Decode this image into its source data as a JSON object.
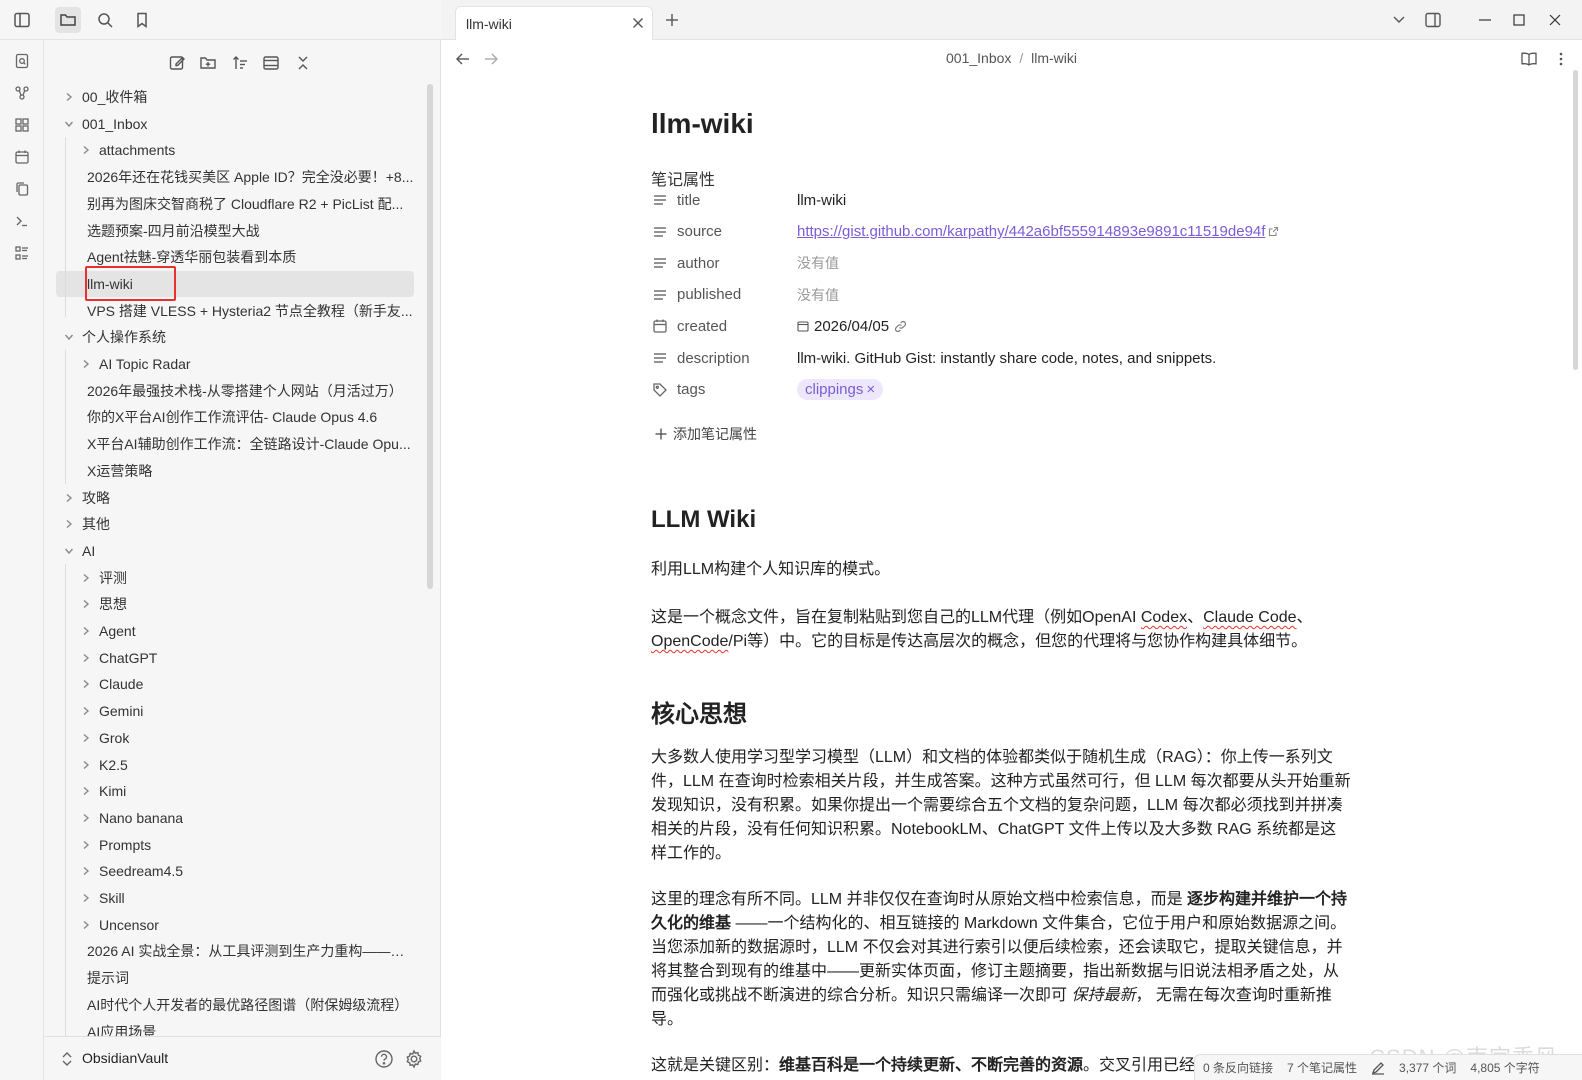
{
  "tab": {
    "title": "llm-wiki"
  },
  "breadcrumb": {
    "folder": "001_Inbox",
    "sep": "/",
    "note": "llm-wiki"
  },
  "tree": [
    {
      "label": "00_收件箱",
      "chev": "right",
      "level": 0
    },
    {
      "label": "001_Inbox",
      "chev": "down",
      "level": 0
    },
    {
      "label": "attachments",
      "chev": "right",
      "level": 1
    },
    {
      "label": "2026年还在花钱买美区 Apple ID？完全没必要！+8...",
      "chev": "none",
      "level": 1
    },
    {
      "label": "别再为图床交智商税了 Cloudflare R2 + PicList 配...",
      "chev": "none",
      "level": 1
    },
    {
      "label": "选题预案-四月前沿模型大战",
      "chev": "none",
      "level": 1
    },
    {
      "label": "Agent祛魅-穿透华丽包装看到本质",
      "chev": "none",
      "level": 1
    },
    {
      "label": "llm-wiki",
      "chev": "none",
      "level": 1,
      "selected": true
    },
    {
      "label": "VPS 搭建 VLESS + Hysteria2 节点全教程（新手友...",
      "chev": "none",
      "level": 1
    },
    {
      "label": "个人操作系统",
      "chev": "down",
      "level": 0
    },
    {
      "label": "AI Topic Radar",
      "chev": "right",
      "level": 1
    },
    {
      "label": "2026年最强技术栈-从零搭建个人网站（月活过万）",
      "chev": "none",
      "level": 1
    },
    {
      "label": "你的X平台AI创作工作流评估- Claude Opus 4.6",
      "chev": "none",
      "level": 1
    },
    {
      "label": "X平台AI辅助创作工作流：全链路设计-Claude Opu...",
      "chev": "none",
      "level": 1
    },
    {
      "label": "X运营策略",
      "chev": "none",
      "level": 1
    },
    {
      "label": "攻略",
      "chev": "right",
      "level": 0
    },
    {
      "label": "其他",
      "chev": "right",
      "level": 0
    },
    {
      "label": "AI",
      "chev": "down",
      "level": 0
    },
    {
      "label": "评测",
      "chev": "right",
      "level": 1
    },
    {
      "label": "思想",
      "chev": "right",
      "level": 1
    },
    {
      "label": "Agent",
      "chev": "right",
      "level": 1
    },
    {
      "label": "ChatGPT",
      "chev": "right",
      "level": 1
    },
    {
      "label": "Claude",
      "chev": "right",
      "level": 1
    },
    {
      "label": "Gemini",
      "chev": "right",
      "level": 1
    },
    {
      "label": "Grok",
      "chev": "right",
      "level": 1
    },
    {
      "label": "K2.5",
      "chev": "right",
      "level": 1
    },
    {
      "label": "Kimi",
      "chev": "right",
      "level": 1
    },
    {
      "label": "Nano banana",
      "chev": "right",
      "level": 1
    },
    {
      "label": "Prompts",
      "chev": "right",
      "level": 1
    },
    {
      "label": "Seedream4.5",
      "chev": "right",
      "level": 1
    },
    {
      "label": "Skill",
      "chev": "right",
      "level": 1
    },
    {
      "label": "Uncensor",
      "chev": "right",
      "level": 1
    },
    {
      "label": "2026 AI 实战全景：从工具评测到生产力重构——老...",
      "chev": "none",
      "level": 1
    },
    {
      "label": "提示词",
      "chev": "none",
      "level": 1
    },
    {
      "label": "AI时代个人开发者的最优路径图谱（附保姆级流程）",
      "chev": "none",
      "level": 1
    },
    {
      "label": "AI应用场景",
      "chev": "none",
      "level": 1
    }
  ],
  "vault": {
    "name": "ObsidianVault"
  },
  "note": {
    "title": "llm-wiki",
    "properties_heading": "笔记属性",
    "properties": [
      {
        "key": "title",
        "icon": "text-icon",
        "value": "llm-wiki",
        "kind": "text"
      },
      {
        "key": "source",
        "icon": "text-icon",
        "value": "https://gist.github.com/karpathy/442a6bf555914893e9891c11519de94f",
        "kind": "link"
      },
      {
        "key": "author",
        "icon": "text-icon",
        "value": "没有值",
        "kind": "empty"
      },
      {
        "key": "published",
        "icon": "text-icon",
        "value": "没有值",
        "kind": "empty"
      },
      {
        "key": "created",
        "icon": "calendar-icon",
        "value": "2026/04/05",
        "kind": "date"
      },
      {
        "key": "description",
        "icon": "text-icon",
        "value": "llm-wiki. GitHub Gist: instantly share code, notes, and snippets.",
        "kind": "text"
      },
      {
        "key": "tags",
        "icon": "tag-icon",
        "value": "clippings",
        "kind": "tag"
      }
    ],
    "add_property": "添加笔记属性",
    "h1": "LLM Wiki",
    "p1": "利用LLM构建个人知识库的模式。",
    "p2_a": "这是一个概念文件，旨在复制粘贴到您自己的LLM代理（例如OpenAI ",
    "p2_b": "Codex",
    "p2_c": "、",
    "p2_d": "Claude Code",
    "p2_e": "、",
    "p2_f": "OpenCode",
    "p2_g": "/Pi等）中。它的目标是传达高层次的概念，但您的代理将与您协作构建具体细节。",
    "h2": "核心思想",
    "p3": "大多数人使用学习型学习模型（LLM）和文档的体验都类似于随机生成（RAG）：你上传一系列文件，LLM 在查询时检索相关片段，并生成答案。这种方式虽然可行，但 LLM 每次都要从头开始重新发现知识，没有积累。如果你提出一个需要综合五个文档的复杂问题，LLM 每次都必须找到并拼凑相关的片段，没有任何知识积累。NotebookLM、ChatGPT 文件上传以及大多数 RAG 系统都是这样工作的。",
    "p4_a": "这里的理念有所不同。LLM 并非仅仅在查询时从原始文档中检索信息，而是 ",
    "p4_b": "逐步构建并维护一个持久化的维基",
    "p4_c": " ——一个结构化的、相互链接的 Markdown 文件集合，它位于用户和原始数据源之间。当您添加新的数据源时，LLM 不仅会对其进行索引以便后续检索，还会读取它，提取关键信息，并将其整合到现有的维基中——更新实体页面，修订主题摘要，指出新数据与旧说法相矛盾之处，从而强化或挑战不断演进的综合分析。知识只需编译一次即可 ",
    "p4_d": "保持最新",
    "p4_e": "， 无需在每次查询时重新推导。",
    "p5_a": "这就是关键区别：",
    "p5_b": "维基百科是一个持续更新、不断完善的资源",
    "p5_c": "。交叉引用已经"
  },
  "status": {
    "backlinks": "0 条反向链接",
    "props": "7 个笔记属性",
    "words": "3,377 个词",
    "chars": "4,805 个字符"
  },
  "watermark": "CSDN @南宫乘风",
  "colors": {
    "accent": "#7c5cd6",
    "highlight_box": "#e5322d"
  }
}
